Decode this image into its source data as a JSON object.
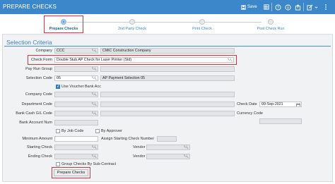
{
  "header": {
    "title": "PREPARE CHECKS",
    "save_label": "Save"
  },
  "wizard": {
    "steps": [
      {
        "label": "Prepare Checks",
        "active": true
      },
      {
        "label": "2nd Party Check",
        "active": false
      },
      {
        "label": "Print Check",
        "active": false
      },
      {
        "label": "Post Check Run",
        "active": false
      }
    ]
  },
  "section": {
    "title": "Selection Criteria"
  },
  "form": {
    "company": {
      "label": "Company",
      "code": "CCC",
      "name": "CMiC Construction Company"
    },
    "check_form": {
      "label": "Check Form",
      "value": "Double Stub AP Check for Laser Printer (Std)"
    },
    "pay_run_group": {
      "label": "Pay Run Group",
      "code": "",
      "name": ""
    },
    "selection_code": {
      "label": "Selection Code",
      "code": "05",
      "name": "AP Payment Selection 05"
    },
    "use_voucher_bank_acc": {
      "label": "Use Voucher Bank Acc",
      "checked": true
    },
    "company_code": {
      "label": "Company Code",
      "value": ""
    },
    "department_code": {
      "label": "Department Code",
      "value": ""
    },
    "bank_cash_gl_code": {
      "label": "Bank Cash G/L Code",
      "value": ""
    },
    "bank_account_num": {
      "label": "Bank Account Num",
      "value": ""
    },
    "check_date": {
      "label": "Check Date",
      "value": "09-Sep-2021"
    },
    "currency_code": {
      "label": "Currency Code",
      "value": ""
    },
    "by_job_code": {
      "label": "By Job Code",
      "checked": false
    },
    "by_approver": {
      "label": "By Approver",
      "checked": false
    },
    "minimum_amount": {
      "label": "Minimum Amount",
      "value": ""
    },
    "assign_starting_check_number": {
      "label": "Assign Starting Check Number",
      "value": ""
    },
    "starting_check": {
      "label": "Starting Check",
      "value": ""
    },
    "ending_check": {
      "label": "Ending Check",
      "value": ""
    },
    "vendor_start": {
      "label": "Vendor",
      "value": ""
    },
    "vendor_end": {
      "label": "Vendor",
      "value": ""
    },
    "group_checks_by_subcontract": {
      "label": "Group Checks By Sub-Contract",
      "checked": false
    }
  },
  "actions": {
    "prepare_checks_label": "Prepare Checks"
  },
  "icons": {
    "save": "save-icon",
    "table": "table-icon",
    "help": "help-icon",
    "info": "info-icon",
    "export": "export-icon",
    "edit": "edit-icon",
    "menu": "kebab-menu-icon",
    "search": "search-icon",
    "calendar": "calendar-icon"
  },
  "colors": {
    "header": "#3b87c9",
    "highlight": "#d9333c",
    "link": "#3b87c9"
  }
}
